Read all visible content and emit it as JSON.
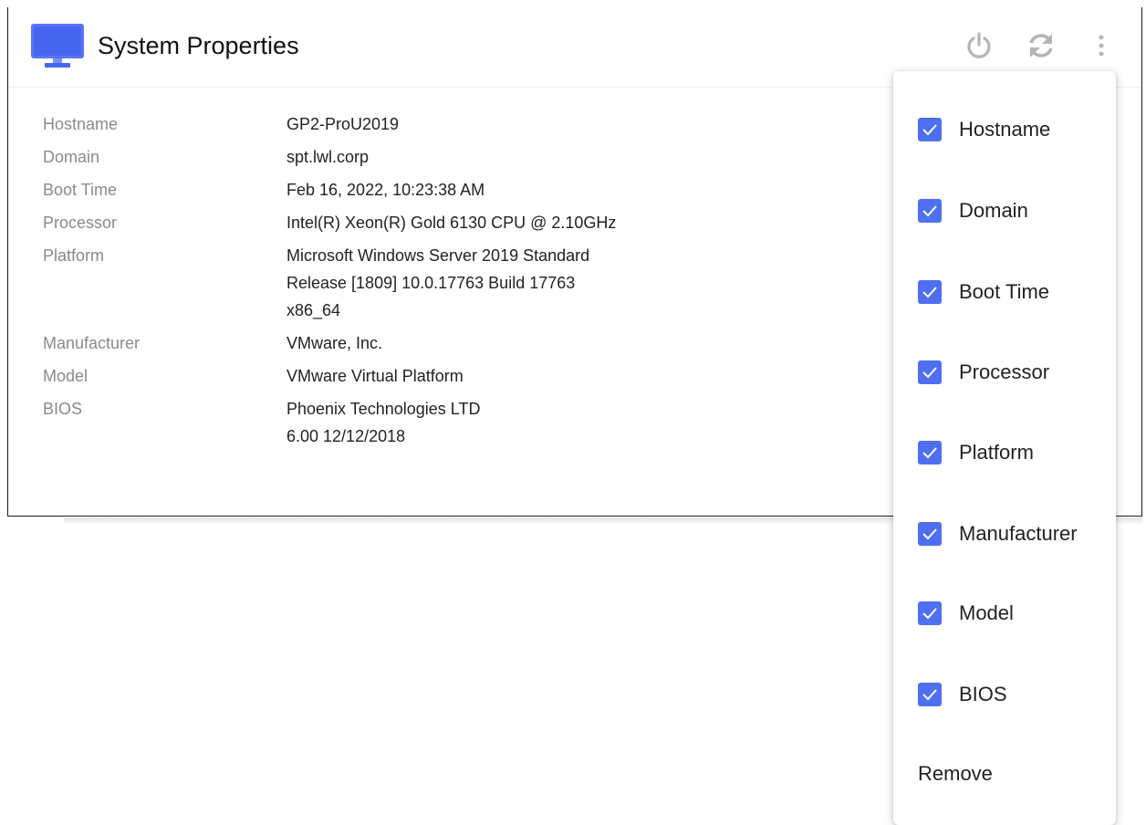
{
  "header": {
    "title": "System Properties",
    "icons": {
      "app": "monitor-icon",
      "power": "power-icon",
      "refresh": "refresh-icon",
      "more": "more-vert-icon"
    }
  },
  "properties": [
    {
      "label": "Hostname",
      "value": "GP2-ProU2019"
    },
    {
      "label": "Domain",
      "value": "spt.lwl.corp"
    },
    {
      "label": "Boot Time",
      "value": "Feb 16, 2022, 10:23:38 AM"
    },
    {
      "label": "Processor",
      "value": "Intel(R) Xeon(R) Gold 6130 CPU @ 2.10GHz"
    },
    {
      "label": "Platform",
      "value": "Microsoft Windows Server 2019 Standard\nRelease [1809] 10.0.17763 Build 17763\nx86_64"
    },
    {
      "label": "Manufacturer",
      "value": "VMware, Inc."
    },
    {
      "label": "Model",
      "value": "VMware Virtual Platform"
    },
    {
      "label": "BIOS",
      "value": "Phoenix Technologies LTD\n6.00 12/12/2018"
    }
  ],
  "menu": {
    "items": [
      {
        "label": "Hostname",
        "checked": true
      },
      {
        "label": "Domain",
        "checked": true
      },
      {
        "label": "Boot Time",
        "checked": true
      },
      {
        "label": "Processor",
        "checked": true
      },
      {
        "label": "Platform",
        "checked": true
      },
      {
        "label": "Manufacturer",
        "checked": true
      },
      {
        "label": "Model",
        "checked": true
      },
      {
        "label": "BIOS",
        "checked": true
      }
    ],
    "remove_label": "Remove"
  },
  "colors": {
    "accent": "#4f6ff2",
    "icon_gray": "#b5b5b5",
    "label_gray": "#8a8a8a"
  }
}
